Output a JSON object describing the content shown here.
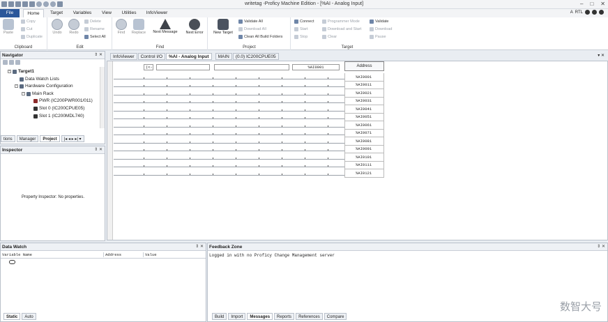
{
  "window": {
    "title": "writetag -Proficy Machine Edition - [%AI - Analog Input]",
    "controls": [
      "–",
      "□",
      "✕"
    ]
  },
  "ribbon_tabs": [
    "File",
    "Home",
    "Target",
    "Variables",
    "View",
    "Utilities",
    "InfoViewer"
  ],
  "ribbon_right": {
    "label": "RTL"
  },
  "clipboard": {
    "paste": "Paste",
    "copy": "Copy",
    "cut": "Cut",
    "duplicate": "Duplicate",
    "label": "Clipboard"
  },
  "edit": {
    "undo": "Undo",
    "redo": "Redo",
    "delete": "Delete",
    "rename": "Rename",
    "select_all": "Select All",
    "label": "Edit"
  },
  "find": {
    "find": "Find",
    "replace": "Replace",
    "next_message": "Next Message",
    "next_error": "Next Error",
    "label": "Find"
  },
  "project": {
    "new_target": "New Target",
    "validate_all": "Validate All",
    "download_all": "Download All",
    "clean_all": "Clean All Build Folders",
    "label": "Project"
  },
  "target": {
    "connect": "Connect",
    "start": "Start",
    "stop": "Stop",
    "programmer_mode": "Programmer Mode",
    "download_and_start": "Download and Start",
    "clear": "Clear",
    "validate": "Validate",
    "download": "Download",
    "pause": "Pause",
    "label": "Target"
  },
  "navigator": {
    "title": "Navigator",
    "pin": "⇕ ✕",
    "tree": [
      {
        "label": "Target1",
        "level": 0,
        "bold": true
      },
      {
        "label": "Data Watch Lists",
        "level": 1
      },
      {
        "label": "Hardware Configuration",
        "level": 1
      },
      {
        "label": "Main Rack",
        "level": 2
      },
      {
        "label": "PWR (IC200PWR001/011)",
        "level": 3
      },
      {
        "label": "Slot 0 (IC200CPUE05)",
        "level": 3
      },
      {
        "label": "Slot 1 (IC200MDL740)",
        "level": 3
      }
    ],
    "tabs": [
      "tions",
      "Manager",
      "Project"
    ],
    "nav_arrows": "|◂ ◂ ▸ ▸| ▾"
  },
  "inspector": {
    "title": "Inspector",
    "pin": "⇕ ✕",
    "empty_text": "Property Inspector: No properties."
  },
  "doc_tabs": [
    "InfoViewer",
    "Control I/O",
    "%AI - Analog Input",
    "MAIN",
    "(0.0) IC200CPUE05"
  ],
  "grid": {
    "header_prefix": "(<-",
    "header_ref": "%AI0001",
    "address_header": "Address",
    "addresses": [
      "%AI0001",
      "%AI0011",
      "%AI0021",
      "%AI0031",
      "%AI0041",
      "%AI0051",
      "%AI0061",
      "%AI0071",
      "%AI0081",
      "%AI0091",
      "%AI0101",
      "%AI0111",
      "%AI0121"
    ]
  },
  "data_watch": {
    "title": "Data Watch",
    "pin": "⇕ ✕",
    "columns": [
      "Variable Name",
      "Address",
      "Value"
    ],
    "tabs": [
      "Static",
      "Auto"
    ]
  },
  "feedback": {
    "title": "Feedback Zone",
    "pin": "⇕ ✕",
    "message": "Logged in with no Proficy Change Management server",
    "tabs": [
      "Build",
      "Import",
      "Messages",
      "Reports",
      "References",
      "Compare"
    ]
  },
  "doc_pin": "▾ ✕",
  "watermark": "数智大号"
}
